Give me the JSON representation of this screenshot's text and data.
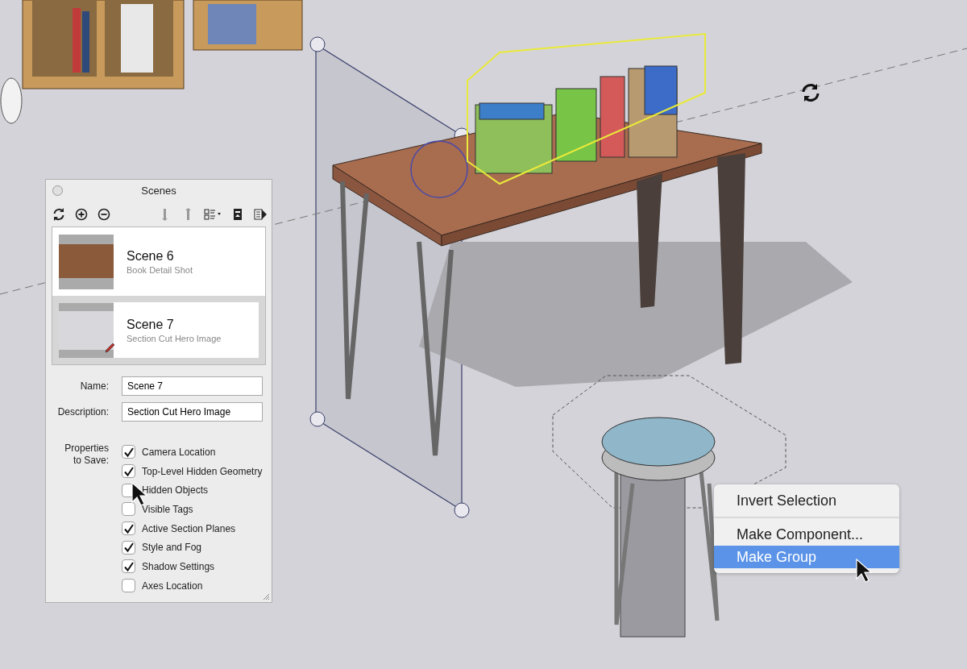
{
  "scenes_panel": {
    "title": "Scenes",
    "scenes": [
      {
        "name": "Scene 6",
        "description": "Book Detail Shot",
        "selected": false,
        "edited": false
      },
      {
        "name": "Scene 7",
        "description": "Section Cut Hero Image",
        "selected": true,
        "edited": true
      }
    ],
    "name_field": {
      "label": "Name:",
      "value": "Scene 7"
    },
    "description_field": {
      "label": "Description:",
      "value": "Section Cut Hero Image"
    },
    "properties_label": "Properties to Save:",
    "properties": [
      {
        "label": "Camera Location",
        "checked": true
      },
      {
        "label": "Top-Level Hidden Geometry",
        "checked": true
      },
      {
        "label": "Hidden Objects",
        "checked": false
      },
      {
        "label": "Visible Tags",
        "checked": false
      },
      {
        "label": "Active Section Planes",
        "checked": true
      },
      {
        "label": "Style and Fog",
        "checked": true
      },
      {
        "label": "Shadow Settings",
        "checked": true
      },
      {
        "label": "Axes Location",
        "checked": false
      }
    ]
  },
  "context_menu": {
    "sections": [
      [
        {
          "label": "Invert Selection",
          "selected": false
        }
      ],
      [
        {
          "label": "Make Component...",
          "selected": false
        },
        {
          "label": "Make Group",
          "selected": true
        }
      ]
    ]
  }
}
